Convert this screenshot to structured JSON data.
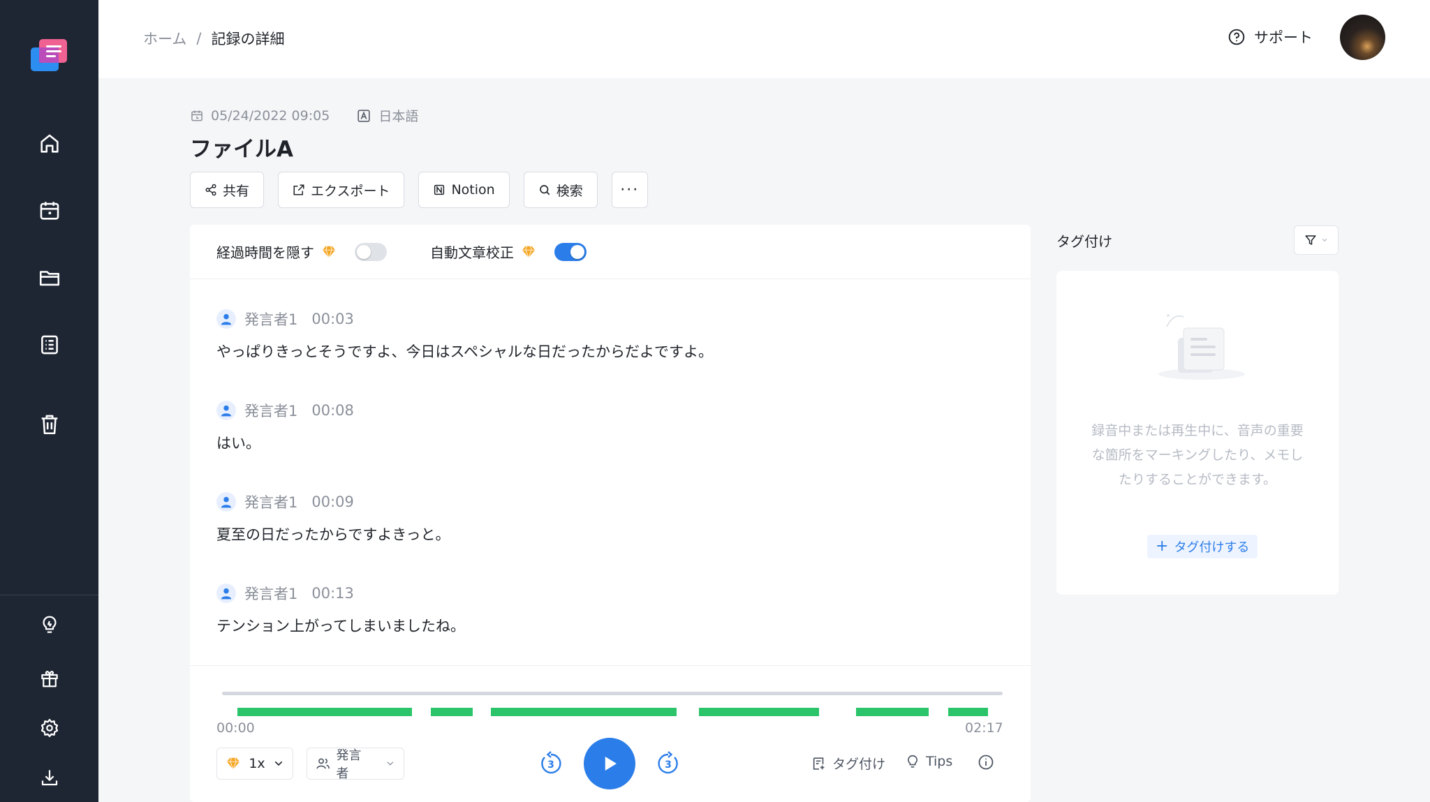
{
  "breadcrumb": {
    "home": "ホーム",
    "separator": "/",
    "current": "記録の詳細"
  },
  "header": {
    "support_label": "サポート"
  },
  "record": {
    "datetime": "05/24/2022 09:05",
    "language": "日本語",
    "title": "ファイルA"
  },
  "toolbar": {
    "share": "共有",
    "export": "エクスポート",
    "notion": "Notion",
    "search": "検索",
    "more": "···"
  },
  "toggles": {
    "hide_elapsed": {
      "label": "経過時間を隠す",
      "on": false
    },
    "auto_correct": {
      "label": "自動文章校正",
      "on": true
    }
  },
  "transcript": [
    {
      "speaker": "発言者1",
      "time": "00:03",
      "text": "やっぱりきっとそうですよ、今日はスペシャルな日だったからだよですよ。"
    },
    {
      "speaker": "発言者1",
      "time": "00:08",
      "text": "はい。"
    },
    {
      "speaker": "発言者1",
      "time": "00:09",
      "text": "夏至の日だったからですよきっと。"
    },
    {
      "speaker": "発言者1",
      "time": "00:13",
      "text": "テンション上がってしまいましたね。"
    }
  ],
  "player": {
    "time_start": "00:00",
    "time_end": "02:17",
    "speed": "1x",
    "speaker_filter": "発言者",
    "skip_seconds": "3",
    "tag_label": "タグ付け",
    "tips_label": "Tips"
  },
  "tags_panel": {
    "title": "タグ付け",
    "empty_message": "録音中または再生中に、音声の重要な箇所をマーキングしたり、メモしたりすることができます。",
    "add_label": "タグ付けする"
  },
  "colors": {
    "sidebar": "#1f2633",
    "accent": "#2b7de9",
    "speech": "#2bc46a",
    "premium": "#f5a623"
  }
}
